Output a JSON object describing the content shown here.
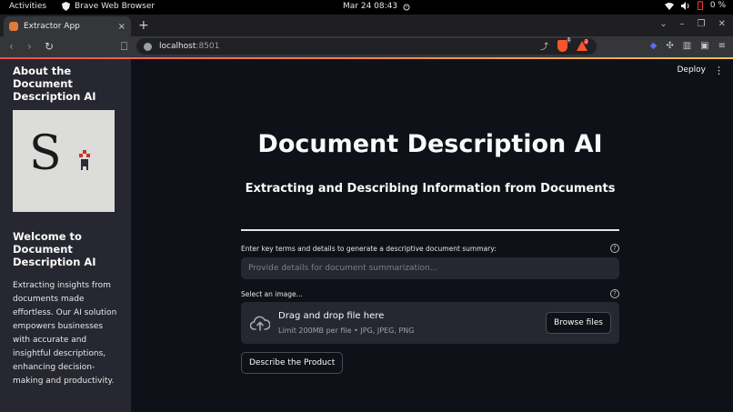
{
  "topbar": {
    "activities": "Activities",
    "app_name": "Brave Web Browser",
    "datetime": "Mar 24  08:43",
    "battery": "0 %"
  },
  "browser": {
    "tab_title": "Extractor App",
    "tab_close": "×",
    "new_tab": "+",
    "url_host": "localhost",
    "url_port": ":8501",
    "shields_count": "1",
    "rewards_count": "2"
  },
  "sidebar": {
    "about_title": "About the Document Description AI",
    "welcome_title": "Welcome to Document Description AI",
    "description": "Extracting insights from documents made effortless. Our AI solution empowers businesses with accurate and insightful descriptions, enhancing decision-making and productivity."
  },
  "header": {
    "deploy_label": "Deploy",
    "menu_glyph": "⋮"
  },
  "main": {
    "title": "Document Description AI",
    "subtitle": "Extracting and Describing Information from Documents",
    "input_label": "Enter key terms and details to generate a descriptive document summary:",
    "input_placeholder": "Provide details for document summarization...",
    "input_value": "",
    "upload_label": "Select an image...",
    "dropzone_title": "Drag and drop file here",
    "dropzone_subtitle": "Limit 200MB per file • JPG, JPEG, PNG",
    "browse_label": "Browse files",
    "describe_label": "Describe the Product"
  },
  "colors": {
    "background": "#0e1117",
    "sidebar": "#262730",
    "widget": "#262730",
    "accent_start": "#ff4b4b",
    "accent_end": "#ffbd45",
    "brave": "#fb542b"
  }
}
